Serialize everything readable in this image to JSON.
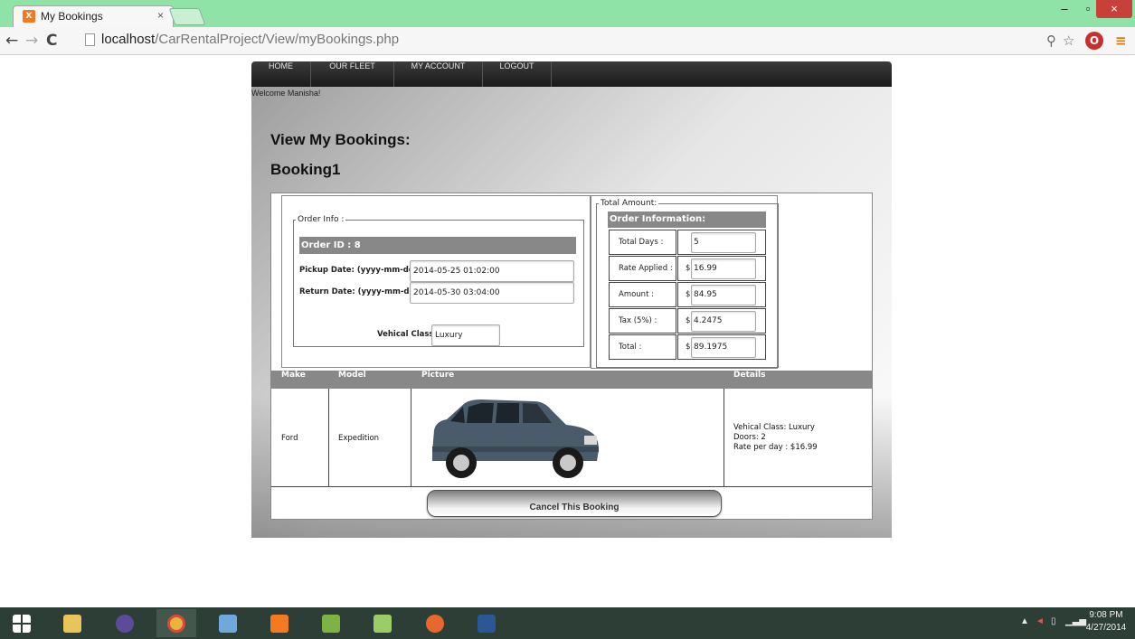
{
  "browser": {
    "tab_title": "My Bookings",
    "tab_close": "×",
    "favicon_text": "X",
    "url_host": "localhost",
    "url_path": "/CarRentalProject/View/myBookings.php",
    "win_min": "–",
    "win_max": "▫",
    "win_close": "×",
    "nav_back": "←",
    "nav_fwd": "→",
    "nav_reload": "C",
    "zoom_icon": "⚲",
    "star_icon": "☆",
    "ext_icon": "O",
    "menu_icon": "≡"
  },
  "site": {
    "menu": [
      "HOME",
      "OUR FLEET",
      "MY ACCOUNT",
      "LOGOUT"
    ],
    "welcome": "Welcome Manisha!",
    "heading": "View My Bookings:",
    "booking_title": "Booking1"
  },
  "order_info": {
    "legend": "Order Info :",
    "order_id": "Order ID : 8",
    "pickup_label": "Pickup Date: (yyyy-mm-dd)",
    "pickup_value": "2014-05-25 01:02:00",
    "return_label": "Return Date: (yyyy-mm-dd)",
    "return_value": "2014-05-30 03:04:00",
    "class_label": "Vehical Class:",
    "class_value": "Luxury"
  },
  "totals": {
    "legend": "Total Amount:",
    "header": "Order Information:",
    "rows": [
      {
        "label": "Total Days :",
        "dollar": "",
        "value": "5"
      },
      {
        "label": "Rate Applied :",
        "dollar": "$",
        "value": "16.99"
      },
      {
        "label": "Amount :",
        "dollar": "$",
        "value": "84.95"
      },
      {
        "label": "Tax (5%) :",
        "dollar": "$",
        "value": "4.2475"
      },
      {
        "label": "Total :",
        "dollar": "$",
        "value": "89.1975"
      }
    ]
  },
  "car_table": {
    "headers": [
      "Make",
      "Model",
      "Picture",
      "Details"
    ],
    "make": "Ford",
    "model": "Expedition",
    "details": [
      "Vehical Class: Luxury",
      "Doors: 2",
      "Rate per day : $16.99"
    ]
  },
  "cancel_button": "Cancel This Booking",
  "taskbar": {
    "time": "9:08 PM",
    "date": "4/27/2014"
  },
  "colors": {
    "tabstrip": "#8fe3a7",
    "header_bar": "#888888",
    "taskbar": "#2d3e36"
  }
}
